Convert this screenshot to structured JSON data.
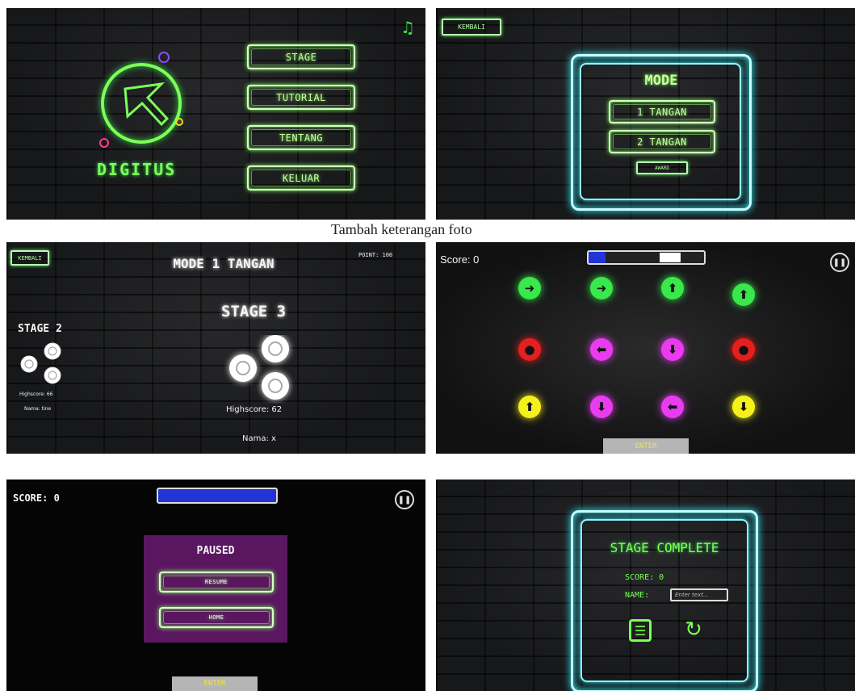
{
  "caption": "Tambah keterangan foto",
  "menu": {
    "logo_text": "DIGITUS",
    "music_icon": "music-note-icon",
    "buttons": [
      "STAGE",
      "TUTORIAL",
      "TENTANG",
      "KELUAR"
    ]
  },
  "mode_select": {
    "back_label": "KEMBALI",
    "title": "MODE",
    "options": [
      "1 TANGAN",
      "2 TANGAN"
    ],
    "small_button": "AWARD"
  },
  "stage_select": {
    "back_label": "KEMBALI",
    "title": "MODE 1 TANGAN",
    "point": "POINT: 100",
    "stage_left": {
      "name": "STAGE 2",
      "highscore": "Highscore: 66",
      "nama": "Nama: tine"
    },
    "stage_center": {
      "name": "STAGE 3",
      "highscore": "Highscore: 62",
      "nama": "Nama: x"
    }
  },
  "game": {
    "score": "Score: 0",
    "enter_label": "ENTER",
    "pause_icon": "pause-icon",
    "progress": 0.15,
    "tiles": [
      {
        "icon": "arrow-right-icon",
        "glyph": "➜",
        "color": "#39e84a"
      },
      {
        "icon": "arrow-right-icon",
        "glyph": "➜",
        "color": "#39e84a"
      },
      {
        "icon": "arrow-up-icon",
        "glyph": "⬆",
        "color": "#39e84a"
      },
      {
        "icon": "arrow-up-icon",
        "glyph": "⬆",
        "color": "#39e84a"
      },
      {
        "icon": "bomb-icon",
        "glyph": "●",
        "color": "#e51e1e"
      },
      {
        "icon": "arrow-left-icon",
        "glyph": "⬅",
        "color": "#e93cf0"
      },
      {
        "icon": "arrow-down-icon",
        "glyph": "⬇",
        "color": "#e93cf0"
      },
      {
        "icon": "bomb-icon",
        "glyph": "●",
        "color": "#e51e1e"
      },
      {
        "icon": "arrow-up-icon",
        "glyph": "⬆",
        "color": "#f5f01a"
      },
      {
        "icon": "arrow-down-icon",
        "glyph": "⬇",
        "color": "#e93cf0"
      },
      {
        "icon": "arrow-left-icon",
        "glyph": "⬅",
        "color": "#e93cf0"
      },
      {
        "icon": "arrow-down-icon",
        "glyph": "⬇",
        "color": "#f5f01a"
      }
    ]
  },
  "paused": {
    "score": "SCORE: 0",
    "title": "PAUSED",
    "resume": "RESUME",
    "home": "HOME",
    "enter_label": "ENTER"
  },
  "complete": {
    "title": "STAGE COMPLETE",
    "score": "SCORE: 0",
    "name_label": "NAME:",
    "name_placeholder": "Enter text...",
    "list_icon": "list-icon",
    "retry_icon": "retry-icon"
  },
  "colors": {
    "neon_green": "#7cff59",
    "neon_cyan": "#2ff1ff",
    "neon_magenta": "#e93cf0"
  }
}
